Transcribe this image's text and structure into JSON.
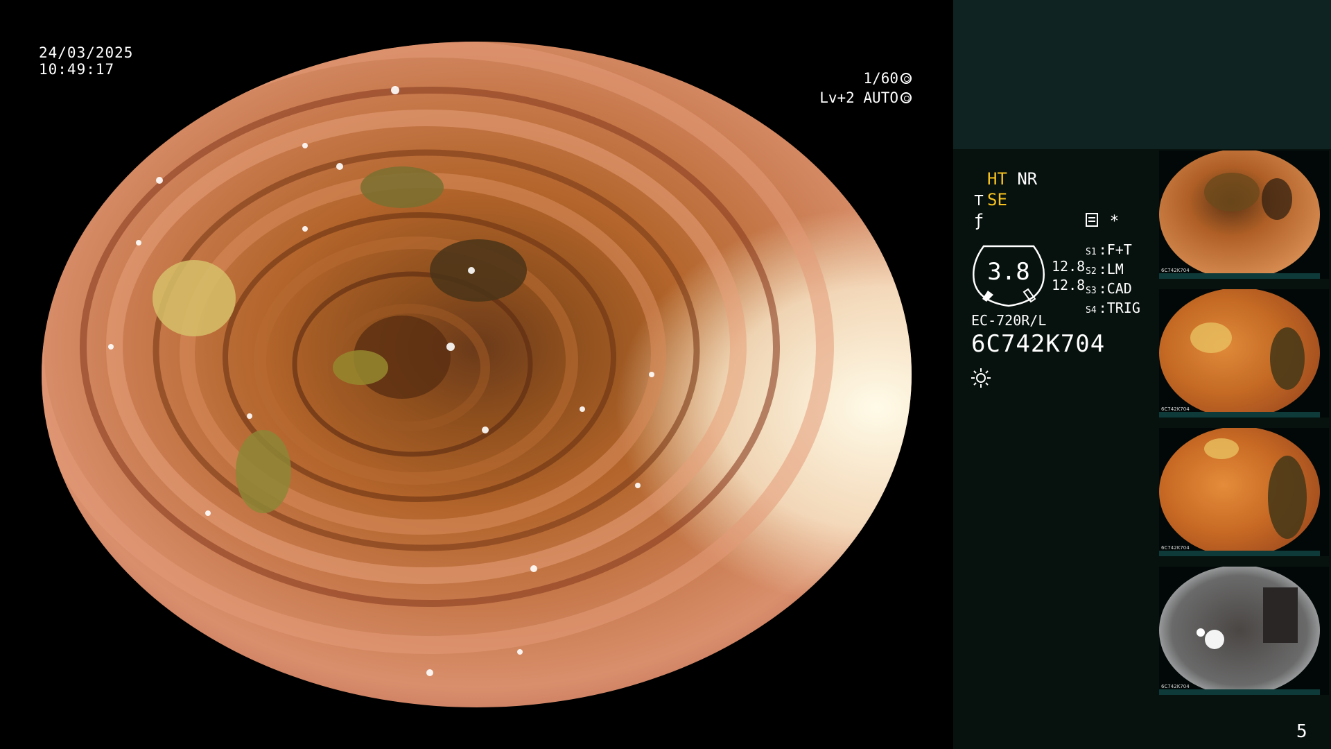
{
  "overlay": {
    "date": "24/03/2025",
    "time": "10:49:17",
    "shutter": "1/60",
    "iris": "Lv+2 AUTO"
  },
  "panel": {
    "mode_ht": "HT",
    "mode_nr": "NR",
    "mode_se": "SE",
    "gauge_value": "3.8",
    "readout_1": "12.8",
    "readout_2": "12.8",
    "asterisk": "*",
    "scope_settings": [
      {
        "label": "S1",
        "value": "F+T"
      },
      {
        "label": "S2",
        "value": "LM"
      },
      {
        "label": "S3",
        "value": "CAD"
      },
      {
        "label": "S4",
        "value": "TRIG"
      }
    ],
    "scope_model": "EC-720R/L",
    "serial_number": "6C742K704"
  },
  "thumbnails": [
    {
      "label": "6C742K704"
    },
    {
      "label": "6C742K704"
    },
    {
      "label": "6C742K704"
    },
    {
      "label": "6C742K704"
    }
  ],
  "page_number": "5",
  "colors": {
    "accent_yellow": "#f7c21e",
    "panel_bg": "#07120f",
    "panel_top": "#0e2322"
  }
}
